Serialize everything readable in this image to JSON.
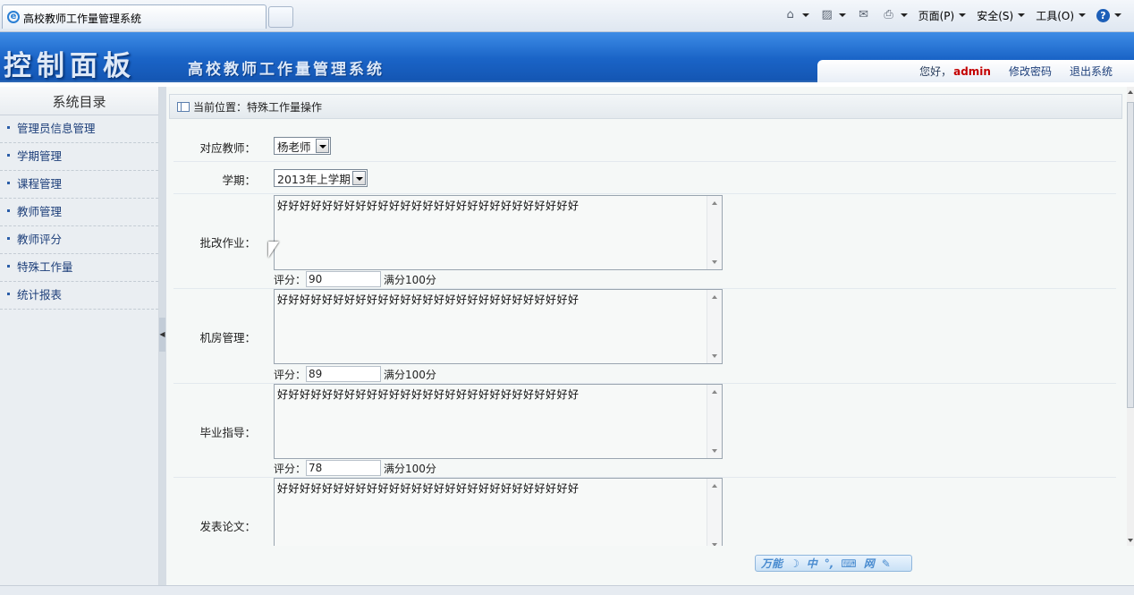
{
  "browser": {
    "tab_title": "高校教师工作量管理系统",
    "commands": {
      "page": "页面(P)",
      "safety": "安全(S)",
      "tools": "工具(O)",
      "help": "?"
    }
  },
  "header": {
    "brand": "控制面板",
    "system_name": "高校教师工作量管理系统",
    "greeting": "您好，",
    "username": "admin",
    "change_password": "修改密码",
    "logout": "退出系统"
  },
  "sidebar": {
    "title": "系统目录",
    "items": [
      {
        "label": "管理员信息管理"
      },
      {
        "label": "学期管理"
      },
      {
        "label": "课程管理"
      },
      {
        "label": "教师管理"
      },
      {
        "label": "教师评分"
      },
      {
        "label": "特殊工作量"
      },
      {
        "label": "统计报表"
      }
    ]
  },
  "breadcrumb": "当前位置：特殊工作量操作",
  "form": {
    "teacher_label": "对应教师：",
    "teacher_value": "杨老师",
    "term_label": "学期：",
    "term_value": "2013年上学期",
    "score_label": "评分：",
    "score_suffix": "满分100分",
    "sections": [
      {
        "label": "批改作业：",
        "text": "好好好好好好好好好好好好好好好好好好好好好好好好好好好",
        "score": "90"
      },
      {
        "label": "机房管理：",
        "text": "好好好好好好好好好好好好好好好好好好好好好好好好好好好",
        "score": "89"
      },
      {
        "label": "毕业指导：",
        "text": "好好好好好好好好好好好好好好好好好好好好好好好好好好好",
        "score": "78"
      },
      {
        "label": "发表论文：",
        "text": "好好好好好好好好好好好好好好好好好好好好好好好好好好好",
        "score": ""
      }
    ]
  },
  "ime_bar": {
    "label": "万能",
    "items": [
      "中",
      "网"
    ]
  }
}
